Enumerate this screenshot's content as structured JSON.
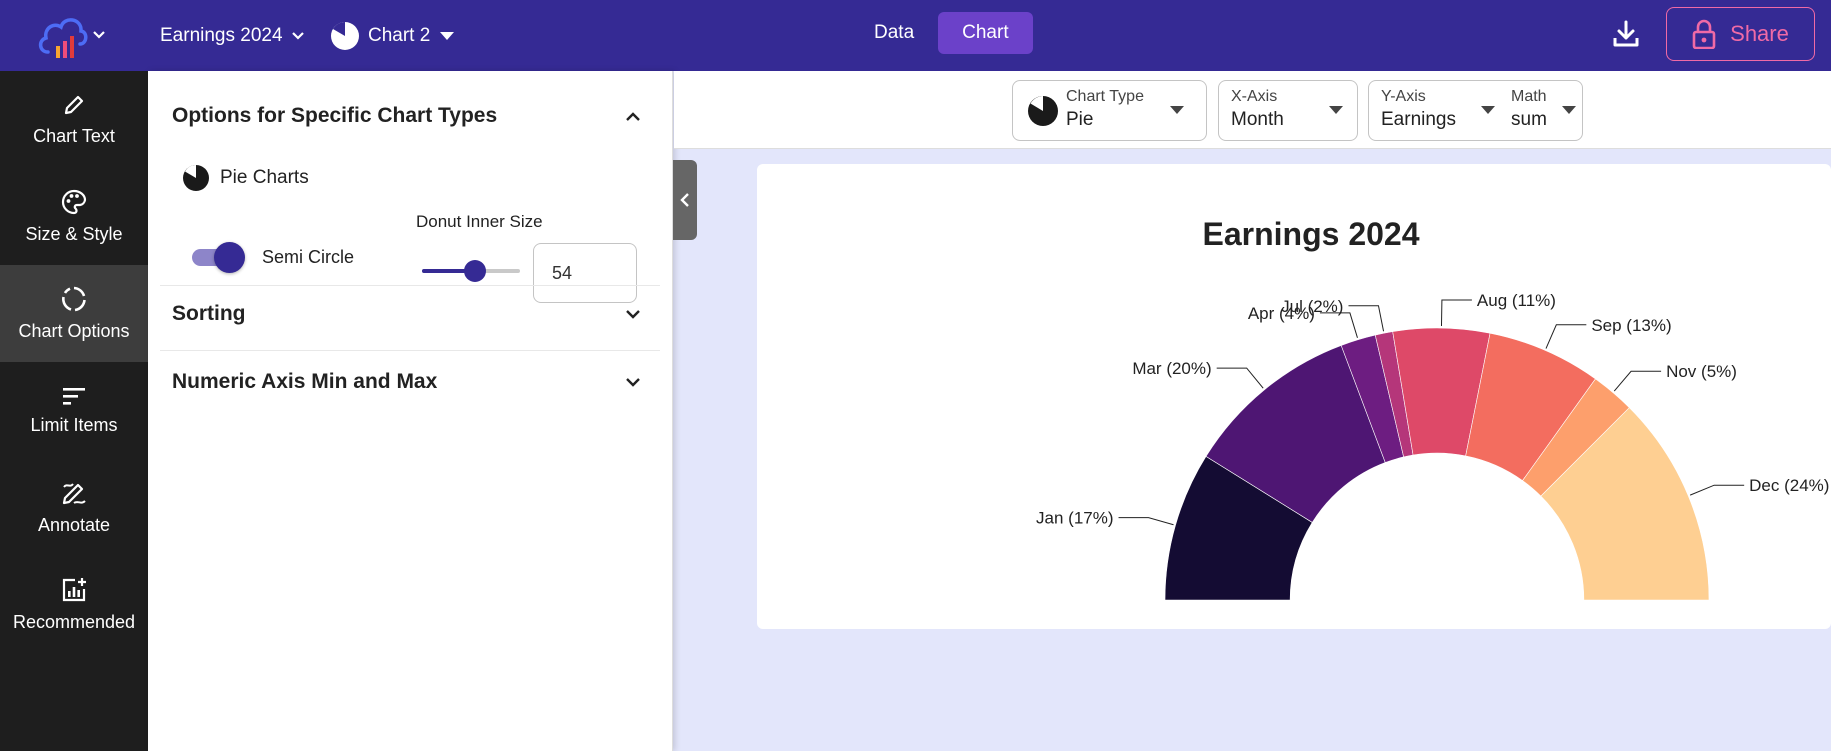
{
  "topbar": {
    "project_name": "Earnings 2024",
    "chart_name": "Chart 2",
    "tabs": [
      {
        "label": "Data",
        "active": false
      },
      {
        "label": "Chart",
        "active": true
      }
    ],
    "share_label": "Share",
    "colors": {
      "bar": "#352a94",
      "active_tab": "#6b41c9",
      "share": "#f06aa6"
    }
  },
  "leftnav": {
    "items": [
      {
        "label": "Chart Text",
        "icon": "pencil-icon",
        "active": false
      },
      {
        "label": "Size & Style",
        "icon": "palette-icon",
        "active": false
      },
      {
        "label": "Chart Options",
        "icon": "circle-segments-icon",
        "active": true
      },
      {
        "label": "Limit Items",
        "icon": "filter-lines-icon",
        "active": false
      },
      {
        "label": "Annotate",
        "icon": "draw-icon",
        "active": false
      },
      {
        "label": "Recommended",
        "icon": "chart-plus-icon",
        "active": false
      }
    ]
  },
  "panel": {
    "section_specific": "Options for Specific Chart Types",
    "pie_heading": "Pie Charts",
    "semi_circle_label": "Semi Circle",
    "semi_circle_on": true,
    "donut_label": "Donut Inner Size",
    "donut_value": "54",
    "donut_slider_fraction": 0.54,
    "section_sorting": "Sorting",
    "section_numeric": "Numeric Axis Min and Max"
  },
  "toolbar": {
    "chart_type_label": "Chart Type",
    "chart_type_value": "Pie",
    "x_axis_label": "X-Axis",
    "x_axis_value": "Month",
    "y_axis_label": "Y-Axis",
    "y_axis_value": "Earnings",
    "math_label": "Math",
    "math_value": "sum"
  },
  "chart_data": {
    "type": "pie",
    "variant": "semi-donut",
    "title": "Earnings 2024",
    "inner_size_percent": 54,
    "slices": [
      {
        "label": "Jan (17%)",
        "month": "Jan",
        "percent": 17,
        "color": "#140c33"
      },
      {
        "label": "Mar (20%)",
        "month": "Mar",
        "percent": 20,
        "color": "#4e1673"
      },
      {
        "label": "Apr (4%)",
        "month": "Apr",
        "percent": 4,
        "color": "#6d1d81"
      },
      {
        "label": "Jul (2%)",
        "month": "Jul",
        "percent": 2,
        "color": "#b5367a"
      },
      {
        "label": "Aug (11%)",
        "month": "Aug",
        "percent": 11,
        "color": "#de4968"
      },
      {
        "label": "Sep (13%)",
        "month": "Sep",
        "percent": 13,
        "color": "#f36d5f"
      },
      {
        "label": "Nov (5%)",
        "month": "Nov",
        "percent": 5,
        "color": "#fd9f6c"
      },
      {
        "label": "Dec (24%)",
        "month": "Dec",
        "percent": 24,
        "color": "#fecf92"
      }
    ]
  }
}
